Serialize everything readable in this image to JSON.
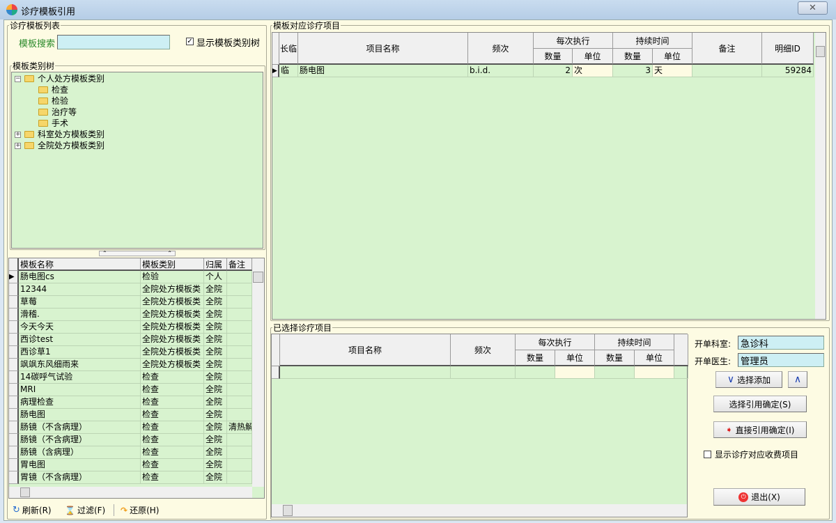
{
  "window": {
    "title": "诊疗模板引用",
    "close": "✕"
  },
  "left": {
    "group_title": "诊疗模板列表",
    "search_label": "模板搜索",
    "search_value": "",
    "show_tree_label": "显示模板类别树",
    "show_tree_checked": true,
    "tree_title": "模板类别树",
    "tree": [
      {
        "label": "个人处方模板类别",
        "level": 0,
        "expander": "−"
      },
      {
        "label": "检查",
        "level": 1
      },
      {
        "label": "检验",
        "level": 1
      },
      {
        "label": "治疗等",
        "level": 1
      },
      {
        "label": "手术",
        "level": 1
      },
      {
        "label": "科室处方模板类别",
        "level": 0,
        "expander": "+"
      },
      {
        "label": "全院处方模板类别",
        "level": 0,
        "expander": "+"
      }
    ],
    "grid": {
      "columns": [
        "模板名称",
        "模板类别",
        "归属",
        "备注"
      ],
      "rows": [
        [
          "肠电图cs",
          "检验",
          "个人",
          ""
        ],
        [
          " 12344",
          "全院处方模板类",
          "全院",
          ""
        ],
        [
          "草莓",
          "全院处方模板类",
          "全院",
          ""
        ],
        [
          "滑稽.",
          "全院处方模板类",
          "全院",
          ""
        ],
        [
          "今天今天",
          "全院处方模板类",
          "全院",
          ""
        ],
        [
          "西诊test",
          "全院处方模板类",
          "全院",
          ""
        ],
        [
          "西诊草1",
          "全院处方模板类",
          "全院",
          ""
        ],
        [
          "飒飒东风细雨来",
          "全院处方模板类",
          "全院",
          ""
        ],
        [
          "14碳呼气试验",
          "检查",
          "全院",
          ""
        ],
        [
          "MRI",
          "检查",
          "全院",
          ""
        ],
        [
          "病理检查",
          "检查",
          "全院",
          ""
        ],
        [
          "肠电图",
          "检查",
          "全院",
          ""
        ],
        [
          "肠镜（不含病理）",
          "检查",
          "全院",
          "清热解"
        ],
        [
          "肠镜（不含病理）",
          "检查",
          "全院",
          ""
        ],
        [
          "肠镜（含病理）",
          "检查",
          "全院",
          ""
        ],
        [
          "胃电图",
          "检查",
          "全院",
          ""
        ],
        [
          "胃镜（不含病理）",
          "检查",
          "全院",
          ""
        ]
      ]
    },
    "toolbar": {
      "refresh": "刷新(R)",
      "filter": "过滤(F)",
      "restore": "还原(H)"
    }
  },
  "template_items": {
    "group_title": "模板对应诊疗项目",
    "headers": {
      "long_temp": "长临",
      "name": "项目名称",
      "freq": "频次",
      "per_exec": "每次执行",
      "duration": "持续时间",
      "qty": "数量",
      "unit": "单位",
      "note": "备注",
      "detail_id": "明细ID"
    },
    "rows": [
      {
        "long_temp": "临",
        "name": "肠电图",
        "freq": "b.i.d.",
        "qty": "2",
        "unit": "次",
        "dur_qty": "3",
        "dur_unit": "天",
        "note": "",
        "detail_id": "59284"
      }
    ]
  },
  "selected_items": {
    "group_title": "已选择诊疗项目",
    "headers": {
      "name": "项目名称",
      "freq": "频次",
      "per_exec": "每次执行",
      "duration": "持续时间",
      "qty": "数量",
      "unit": "单位"
    }
  },
  "side": {
    "dept_label": "开单科室:",
    "dept_value": "急诊科",
    "doctor_label": "开单医生:",
    "doctor_value": "管理员",
    "add_button": "选择添加",
    "up_button": "∧",
    "confirm_select": "选择引用确定(S)",
    "confirm_direct": "直接引用确定(I)",
    "show_fee_label": "显示诊疗对应收费项目",
    "show_fee_checked": false,
    "exit": "退出(X)"
  },
  "colors": {
    "grid_bg": "#d8f3cf",
    "panel_bg": "#fdfbe3",
    "input_bg": "#cdeff4",
    "label_green": "#2a8a2a"
  }
}
